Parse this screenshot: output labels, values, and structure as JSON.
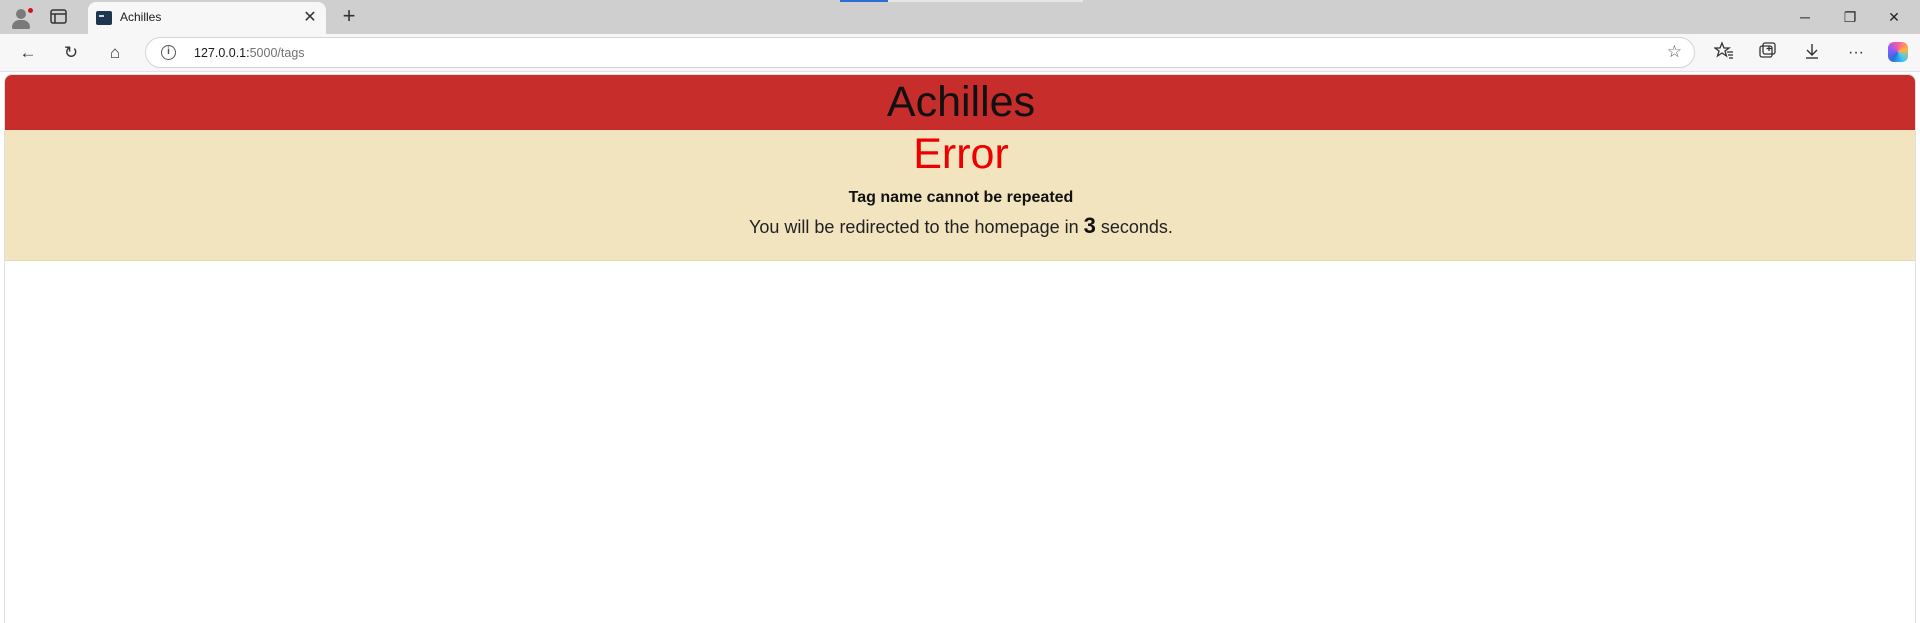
{
  "browser": {
    "tab": {
      "title": "Achilles",
      "close_glyph": "✕"
    },
    "new_tab_glyph": "+",
    "window_controls": {
      "minimize": "─",
      "restore": "❐",
      "close": "✕"
    },
    "nav": {
      "back": "←",
      "reload": "↻",
      "home": "⌂"
    },
    "address": {
      "host": "127.0.0.1:",
      "path": "5000/tags"
    },
    "icons": [
      "profile-icon",
      "tab-actions-icon",
      "site-info-icon",
      "favorite-star-icon",
      "favorites-icon",
      "collections-icon",
      "downloads-icon",
      "more-icon",
      "copilot-icon"
    ]
  },
  "page": {
    "site_title": "Achilles",
    "error": {
      "heading": "Error",
      "message": "Tag name cannot be repeated",
      "redirect_prefix": "You will be redirected to the homepage in",
      "redirect_count": "3",
      "redirect_suffix": "seconds."
    }
  },
  "colors": {
    "header_bg": "#c62d2b",
    "error_panel_bg": "#f3e4c0",
    "error_heading": "#ee0000"
  }
}
